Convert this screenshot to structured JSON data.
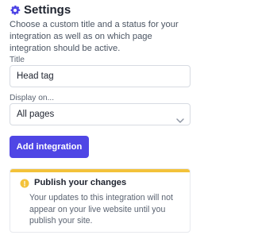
{
  "settings": {
    "title": "Settings",
    "description": "Choose a custom title and a status for your integration as well as on which page integration should be active."
  },
  "form": {
    "title_label": "Title",
    "title_value": "Head tag",
    "display_label": "Display on...",
    "display_selected": "All pages",
    "add_button_label": "Add integration"
  },
  "callout": {
    "title": "Publish your changes",
    "body": "Your updates to this integration will not appear on your live website until you publish your site.",
    "accent_color": "#f3c23a",
    "icon": "info-icon"
  },
  "colors": {
    "brand": "#4f46e5",
    "text": "#1f2430",
    "muted": "#5b6472",
    "border": "#d7dbe2"
  },
  "icons": {
    "settings": "gear-icon",
    "select": "chevron-down-icon"
  }
}
